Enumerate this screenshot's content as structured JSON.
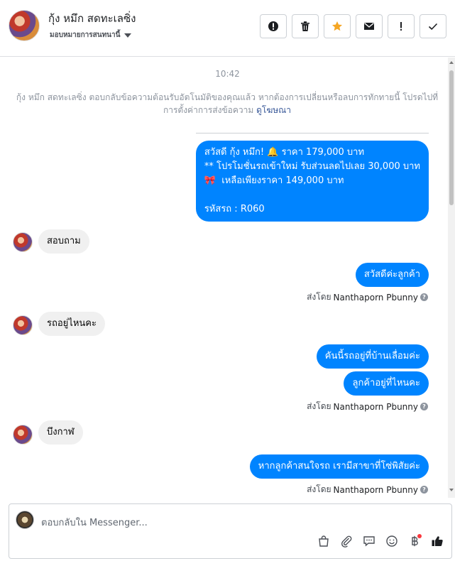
{
  "header": {
    "title": "กุ้ง หมึก สดทะเลซิ่ง",
    "assign_label": "มอบหมายการสนทนานี้"
  },
  "conversation": {
    "time": "10:42",
    "notice_text": "กุ้ง หมึก สดทะเลซิ่ง ตอบกลับข้อความต้อนรับอัตโนมัติของคุณแล้ว หากต้องการเปลี่ยนหรือลบการทักทายนี้ โปรดไปที่การตั้งค่าการส่งข้อความ",
    "notice_link": "ดูโฆษณา",
    "messages": [
      {
        "direction": "out",
        "text": "สวัสดี กุ้ง หมึก! 🔔 ราคา 179,000 บาท\n** โปรโมชั่นรถเข้าใหม่ รับส่วนลดไปเลย 30,000 บาท\n🎀  เหลือเพียงราคา 149,000 บาท\n\nรหัสรถ : R060"
      },
      {
        "direction": "in",
        "text": "สอบถาม"
      },
      {
        "direction": "out",
        "text": "สวัสดีค่ะลูกค้า"
      },
      {
        "direction": "in",
        "text": "รถอยู่ไหนคะ"
      },
      {
        "direction": "out",
        "text": "คันนี้รถอยู่ที่บ้านเลื่อมค่ะ"
      },
      {
        "direction": "out",
        "text": "ลูกค้าอยู่ที่ไหนคะ"
      },
      {
        "direction": "in",
        "text": "บึงกาฬ"
      },
      {
        "direction": "out",
        "text": "หากลูกค้าสนใจรถ เรามีสาขาที่โซ่พิสัยค่ะ"
      }
    ],
    "sent_by_prefix": "ส่งโดย",
    "sent_by_name": "Nanthaporn Pbunny"
  },
  "composer": {
    "placeholder": "ตอบกลับใน Messenger..."
  },
  "icons": {
    "header_actions": [
      "alert-icon",
      "trash-icon",
      "star-icon",
      "envelope-icon",
      "exclamation-icon",
      "check-icon"
    ],
    "composer_tools": [
      "bag-icon",
      "paperclip-icon",
      "chat-bubble-icon",
      "smiley-icon",
      "baht-icon",
      "thumbs-up-icon"
    ]
  },
  "colors": {
    "accent": "#0084ff",
    "star": "#f5a623",
    "incoming_bubble": "#f0f0f0",
    "link": "#385898"
  }
}
